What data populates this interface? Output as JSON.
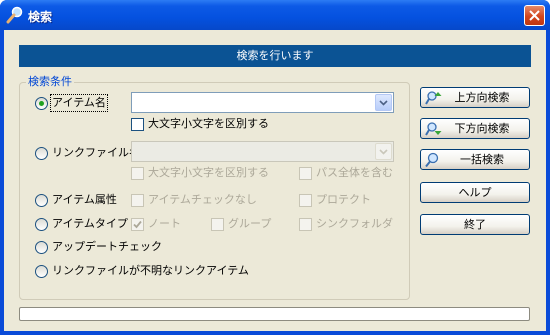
{
  "window": {
    "title": "検索"
  },
  "banner": {
    "text": "検索を行います"
  },
  "conditions": {
    "legend": "検索条件",
    "item_name": {
      "label": "アイテム名",
      "value": "",
      "case_label": "大文字小文字を区別する",
      "case_checked": false
    },
    "link_file_name": {
      "label": "リンクファイル名",
      "value": "",
      "case_label": "大文字小文字を区別する",
      "full_path_label": "パス全体を含む"
    },
    "item_attribute": {
      "label": "アイテム属性",
      "no_check_label": "アイテムチェックなし",
      "protect_label": "プロテクト"
    },
    "item_type": {
      "label": "アイテムタイプ",
      "note_label": "ノート",
      "note_checked": true,
      "group_label": "グループ",
      "symlink_label": "シンクフォルダ"
    },
    "update_check": {
      "label": "アップデートチェック"
    },
    "unknown_link": {
      "label": "リンクファイルが不明なリンクアイテム"
    },
    "selected": "item_name"
  },
  "buttons": {
    "search_up": "上方向検索",
    "search_down": "下方向検索",
    "search_all": "一括検索",
    "help": "ヘルプ",
    "close": "終了"
  },
  "icons": {
    "title": "magnifier-icon",
    "close": "close-icon",
    "search_up": "search-up-icon",
    "search_down": "search-down-icon",
    "search_all": "search-all-icon"
  },
  "colors": {
    "titlebar": "#0551df",
    "banner": "#0b5394",
    "legend": "#0046d5",
    "client": "#ece9d8"
  }
}
